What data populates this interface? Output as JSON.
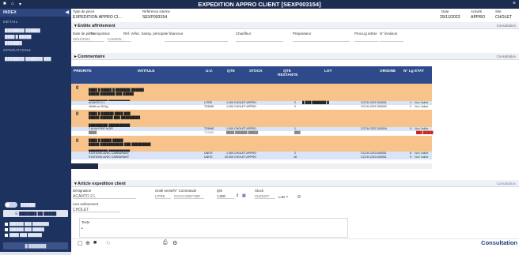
{
  "window": {
    "title": "EXPEDITION APPRO CLIENT [SEXP003154]",
    "home_icon": "home-icon",
    "menu_icon": "dropdown-icon",
    "close_icon": "close-icon"
  },
  "sidebar": {
    "header": "INDEX",
    "sections": [
      {
        "label": "DETAIL",
        "items": [
          "████████ ██████",
          "████ █ █████",
          "███████"
        ]
      },
      {
        "label": "OPERATIONS",
        "items": [
          "████████ ███████ ███"
        ]
      }
    ],
    "toggle_label": "██████",
    "filter_button": "☰ ███████ ██ █████",
    "checks": [
      "██████ ███ ███████",
      "██████ ███ █████",
      "████ ███ ██████"
    ],
    "button1": "█ ███████",
    "button2": "█ ██████"
  },
  "header": {
    "type_label": "Type de pièce",
    "type_value": "EXPEDITION APPRO CI...",
    "ref_label": "Référence interne",
    "ref_value": "SEXP003154",
    "date_label": "Date",
    "date_value": "29/11/2022",
    "activity_label": "Activité",
    "activity_value": "APPRO",
    "site_label": "Site",
    "site_value": "CHOLET"
  },
  "entete": {
    "title": "▾ Entête affrètement",
    "consult": "Consultation",
    "labels": [
      "Date de pièce",
      "Transporteur",
      "Réf. Véhic. transp. principale financeur",
      "Chauffeur",
      "Préparateur",
      "Prov.Lig article",
      "N° livraison"
    ],
    "values": [
      "29/11/2022",
      "CAMION"
    ]
  },
  "commentaire": {
    "title": "▸ Commentaire",
    "consult": "Consultation"
  },
  "grid": {
    "columns": [
      "PRIORITE",
      "INTITULE",
      "U.V.",
      "QTE",
      "STOCK",
      "QTE RESTANTE",
      "LOT",
      "ORIGINE",
      "N° Lg",
      "ETAT"
    ],
    "groups": [
      {
        "priority": "0",
        "lines": [
          "████ █ █████ █ ███████ ██████",
          "█████ ███████ ███ █████"
        ],
        "info": "█████████ ██████████",
        "rows": [
          {
            "intitule": "ACANTO 2 L",
            "uv": "LITRE",
            "qte": "1.000 CHOLET APPRO",
            "stock": "",
            "reste": "2",
            "lot": "█-███ ███████ █",
            "origine": "CCCH-2207-000001",
            "lg": "1",
            "etat": "Non Valide"
          },
          {
            "intitule": "16/46 ou 25 Kg",
            "uv": "TONNE",
            "qte": "1.000 CHOLET APPRO",
            "stock": "",
            "reste": "2",
            "lot": "",
            "origine": "CCCH-2207-000002",
            "lg": "2",
            "etat": "Non Valide"
          }
        ]
      },
      {
        "priority": "0",
        "lines": [
          "████ █ ██████ ████ ███",
          "█████ ██████ ███ █████████"
        ],
        "info": "█████████ ██████████",
        "rows": [
          {
            "intitule": "T ALIM PIGE NOIR",
            "uv": "TONNE",
            "qte": "1.000 CHOLET APPRO",
            "stock": "",
            "reste": "1",
            "lot": "",
            "origine": "CCCH-2207-000004",
            "lg": "5",
            "etat": "Non Valide"
          },
          {
            "intitule": "████",
            "uv": "TONNE",
            "qte": "████ ██████ █████",
            "stock": "",
            "reste": "███",
            "lot": "",
            "origine": "",
            "lg": "",
            "etat": "███ █████"
          }
        ]
      },
      {
        "priority": "0",
        "lines": [
          "████ █ █████ █████",
          "█████ ███████████ ███ █████████"
        ],
        "info": "█████████ ██████████",
        "rows": [
          {
            "intitule": "STATIONS AVEC CARBURANT",
            "uv": "UNITE",
            "qte": "1.000 CHOLET APPRO",
            "stock": "",
            "reste": "2",
            "lot": "",
            "origine": "CCCH-2210-000001",
            "lg": "8",
            "etat": "Non Valide"
          },
          {
            "intitule": "STATIONS AVEC CARBURANT",
            "uv": "UNITE",
            "qte": "20.000 CHOLET APPRO",
            "stock": "",
            "reste": "18",
            "lot": "",
            "origine": "CCCH-2210-000001",
            "lg": "9",
            "etat": "Non Valide"
          }
        ]
      }
    ]
  },
  "article": {
    "title": "▾ Article expedition client",
    "consult": "Consultation",
    "designation_label": "Désignation",
    "designation_value": "ACANTO 2 L",
    "commande_label": "Unité vente/N° Commande",
    "commande_uv": "LITRE",
    "commande_value": "CCCH-2207-000",
    "qte_label": "Qté",
    "qte_value": "1.000",
    "stock_label": "Stock",
    "stock_value": "CHOLET-",
    "lot_label": "Lots ?",
    "lieu_label": "Lieu enlèvement",
    "lieu_value": "CHOLET",
    "texte_label": "Texte"
  },
  "toolbar": {
    "consult": "Consultation"
  }
}
